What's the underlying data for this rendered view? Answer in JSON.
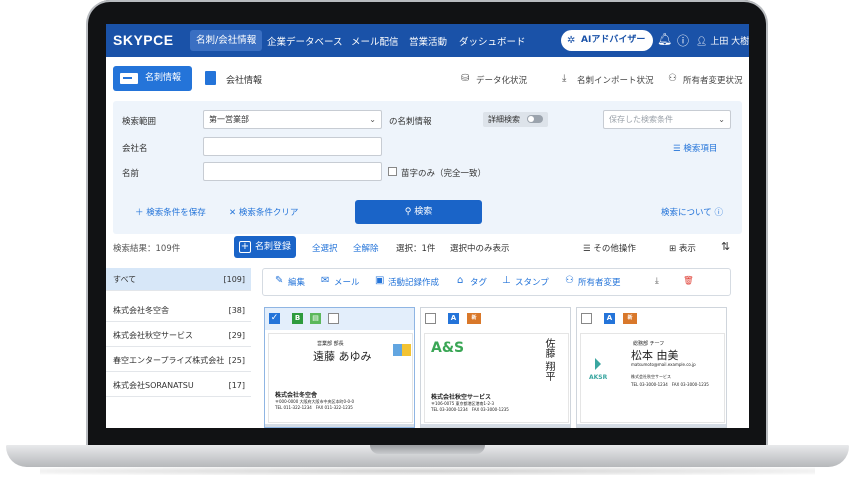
{
  "nav": {
    "logo": "SKYPCE",
    "items": [
      "名刺/会社情報",
      "企業データベース",
      "メール配信",
      "営業活動",
      "ダッシュボード"
    ],
    "ai_button": "AIアドバイザー",
    "user": "上田 大樹"
  },
  "subbar": {
    "tab_cards": "名刺情報",
    "tab_company": "会社情報",
    "links": [
      "データ化状況",
      "名刺インポート状況",
      "所有者変更状況"
    ]
  },
  "search": {
    "scope_label": "検索範囲",
    "scope_value": "第一営業部",
    "scope_suffix": "の名刺情報",
    "detail_toggle": "詳細検索",
    "saved_placeholder": "保存した検索条件",
    "company_label": "会社名",
    "name_label": "名前",
    "surname_only": "苗字のみ（完全一致）",
    "fields_link": "検索項目",
    "save_link": "検索条件を保存",
    "clear_link": "検索条件クリア",
    "search_button": "検索",
    "about_link": "検索について"
  },
  "results": {
    "count": "検索結果：109件",
    "register_button": "名刺登録",
    "select_all": "全選択",
    "deselect_all": "全解除",
    "selected": "選択：1件",
    "show_selected": "選択中のみ表示",
    "other_ops": "その他操作",
    "display": "表示"
  },
  "sidebar": [
    {
      "name": "すべて",
      "count": "[109]"
    },
    {
      "name": "株式会社冬空舎",
      "count": "[38]"
    },
    {
      "name": "株式会社秋空サービス",
      "count": "[29]"
    },
    {
      "name": "春空エンタープライズ株式会社",
      "count": "[25]"
    },
    {
      "name": "株式会社SORANATSU",
      "count": "[17]"
    }
  ],
  "actions": [
    "編集",
    "メール",
    "活動記録作成",
    "タグ",
    "スタンプ",
    "所有者変更"
  ],
  "cards": [
    {
      "title": "営業部 部長",
      "name": "遠藤 あゆみ",
      "company": "株式会社冬空舎",
      "addr": "〒000-0000 大阪府大阪市中央区本町0-0-0",
      "tel": "TEL 011-322-1234　FAX 011-322-1235"
    },
    {
      "logo": "A&S",
      "name": "佐藤 翔平",
      "company": "株式会社秋空サービス",
      "addr": "〒106-0075 東京都港区港南1-2-3",
      "tel": "TEL 03-3000-1234　FAX 03-3000-1235"
    },
    {
      "logo": "AKSR",
      "title": "総務部 チーフ",
      "name": "松本 由美",
      "email": "matsumoto@mail.example.co.jp",
      "company": "株式会社秋空サービス",
      "tel": "TEL 03-3000-1234　FAX 03-3000-1235"
    }
  ],
  "colors": {
    "nav": "#1a52a8",
    "accent": "#2474d9",
    "panel": "#eef4fb",
    "danger": "#e0443a"
  }
}
